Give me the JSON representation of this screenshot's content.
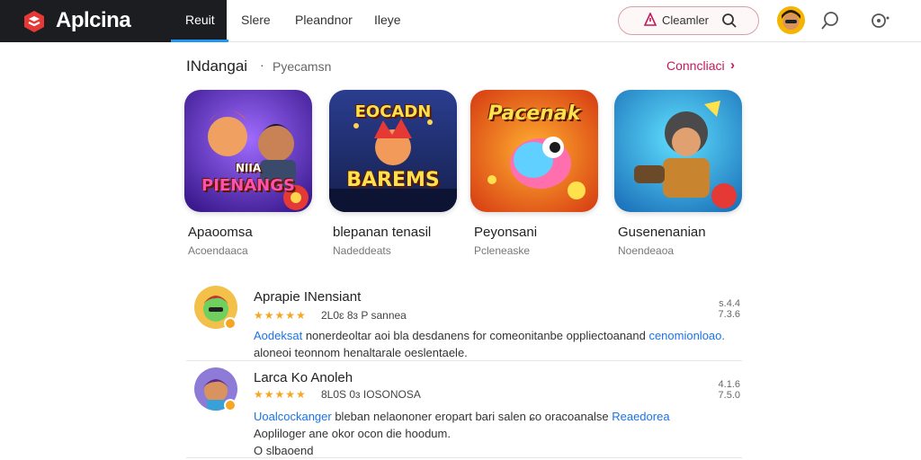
{
  "app": {
    "name": "Aplcina"
  },
  "nav": {
    "active": "Reuit",
    "items": [
      "Slere",
      "Pleandnor",
      "Ileye"
    ]
  },
  "search": {
    "text": "Cleamler"
  },
  "section": {
    "title": "INdangai",
    "separator": "·",
    "subtitle": "Pyecamsn",
    "link": "Conncliaci"
  },
  "cards": [
    {
      "name": "Apaoomsa",
      "developer": "Acoendaaca",
      "art_title": "PIENANGS",
      "art_title_top": "NIIA"
    },
    {
      "name": "blepanan tenasil",
      "developer": "Nadeddeats",
      "art_title": "BAREMS",
      "art_title_top": "EOCADN"
    },
    {
      "name": "Peyonsani",
      "developer": "Pcleneaske",
      "art_title": "Pacenak",
      "art_title_top": ""
    },
    {
      "name": "Gusenenanian",
      "developer": "Noendeaoa",
      "art_title": "",
      "art_title_top": ""
    }
  ],
  "list": [
    {
      "title": "Aprapie INensiant",
      "stars": "★★★★★",
      "meta": "2L0ɛ 8ɜ P sannea",
      "rank_top": "s.4.4",
      "rank_bottom": "7.3.6",
      "desc_blue_start": "Aodeksat",
      "desc_mid": " nonerdeoltar aoi bla desdanens for comeonitanbe oppliectoanand ",
      "desc_blue_end": "cenomionloao.",
      "desc_line2": "aloneoi teonnom henaltarale oeslentaele."
    },
    {
      "title": "Larca Ko Anoleh",
      "stars": "★★★★★",
      "meta": "8L0S 0ɜ IOSONOSA",
      "rank_top": "4.1.6",
      "rank_bottom": "7.5.0",
      "desc_blue_start": "Uoalcockanger",
      "desc_mid": " bleban nelaononer eropart bari salen ɕo oracoanalse ",
      "desc_blue_end": "Reaedorea",
      "desc_line2": "Aopliloger ane okor ocon die hoodum.",
      "desc_line3": "O slbaoend"
    }
  ],
  "colors": {
    "brand_bar": "#1c1d20",
    "accent_blue": "#2196f3",
    "link_red": "#c2185b",
    "star": "#f5a623"
  }
}
